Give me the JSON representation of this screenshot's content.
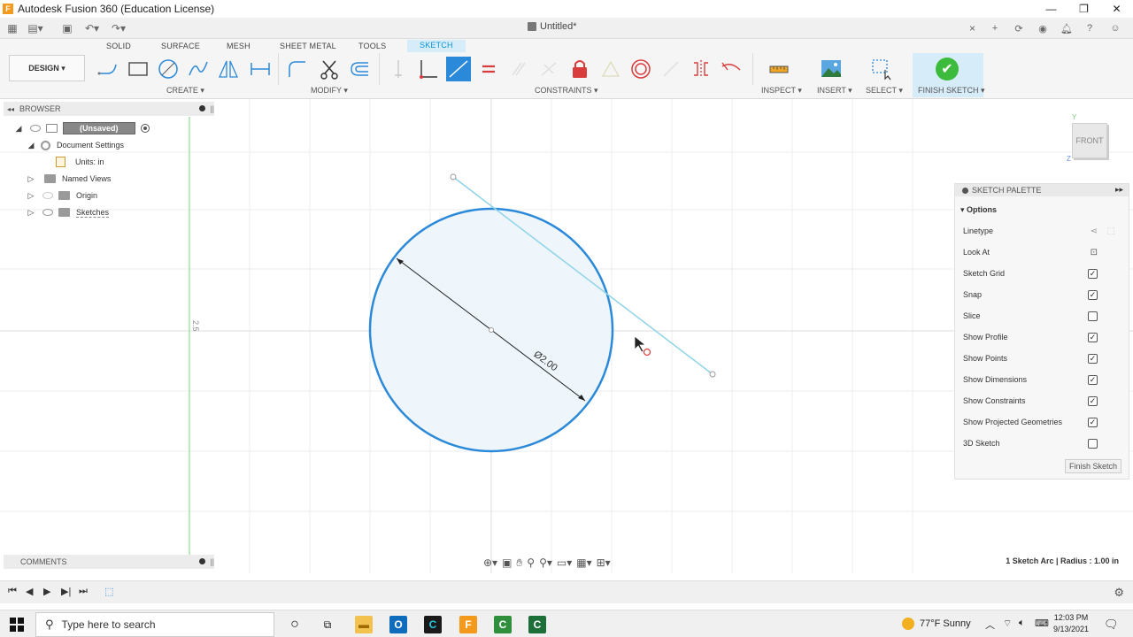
{
  "window": {
    "title": "Autodesk Fusion 360 (Education License)",
    "logo_letter": "F",
    "controls": [
      "—",
      "❐",
      "✕"
    ]
  },
  "document": {
    "tab_title": "Untitled*",
    "close": "×"
  },
  "workspace_tabs": [
    "SOLID",
    "SURFACE",
    "MESH",
    "SHEET METAL",
    "TOOLS",
    "SKETCH"
  ],
  "active_tab": "SKETCH",
  "toolbar": {
    "design_label": "DESIGN ▾",
    "groups": {
      "create": "CREATE ▾",
      "modify": "MODIFY ▾",
      "constraints": "CONSTRAINTS ▾",
      "inspect": "INSPECT ▾",
      "insert": "INSERT ▾",
      "select": "SELECT ▾",
      "finish": "FINISH SKETCH ▾"
    },
    "finish_check": "✔"
  },
  "browser": {
    "title": "BROWSER",
    "items": [
      {
        "label": "(Unsaved)"
      },
      {
        "label": "Document Settings"
      },
      {
        "label": "Units: in"
      },
      {
        "label": "Named Views"
      },
      {
        "label": "Origin"
      },
      {
        "label": "Sketches"
      }
    ]
  },
  "canvas": {
    "dimension_label": "Ø2.00",
    "axis_label": "2.5"
  },
  "viewcube": {
    "face": "FRONT",
    "axis_y": "Y",
    "axis_z": "Z"
  },
  "sketch_palette": {
    "title": "SKETCH PALETTE",
    "section": "Options",
    "options": [
      {
        "label": "Linetype",
        "control": "icons"
      },
      {
        "label": "Look At",
        "control": "icon"
      },
      {
        "label": "Sketch Grid",
        "checked": true
      },
      {
        "label": "Snap",
        "checked": true
      },
      {
        "label": "Slice",
        "checked": false
      },
      {
        "label": "Show Profile",
        "checked": true
      },
      {
        "label": "Show Points",
        "checked": true
      },
      {
        "label": "Show Dimensions",
        "checked": true
      },
      {
        "label": "Show Constraints",
        "checked": true
      },
      {
        "label": "Show Projected Geometries",
        "checked": true
      },
      {
        "label": "3D Sketch",
        "checked": false
      }
    ],
    "finish_button": "Finish Sketch"
  },
  "comments": {
    "title": "COMMENTS"
  },
  "status": {
    "text": "1 Sketch Arc | Radius : 1.00 in"
  },
  "taskbar": {
    "search_placeholder": "Type here to search",
    "weather": "77°F  Sunny",
    "time": "12:03 PM",
    "date": "9/13/2021"
  },
  "colors": {
    "accent": "#0696d7",
    "circle": "#2b89d9",
    "line": "#8fd3e8",
    "finish_green": "#3dbb3d"
  }
}
